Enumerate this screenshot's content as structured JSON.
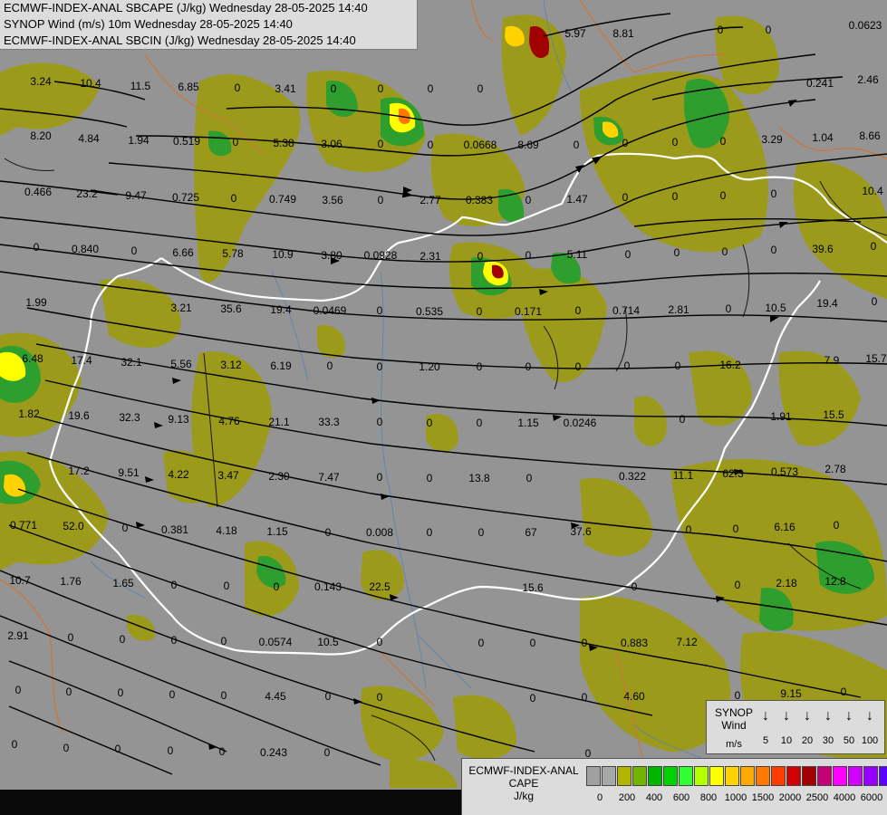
{
  "header": {
    "line1": "ECMWF-INDEX-ANAL SBCAPE (J/kg) Wednesday 28-05-2025 14:40",
    "line2": "SYNOP Wind (m/s) 10m Wednesday 28-05-2025 14:40",
    "line3": "ECMWF-INDEX-ANAL SBCIN (J/kg) Wednesday 28-05-2025 14:40"
  },
  "values": [
    "3.24",
    "10.4",
    "11.5",
    "6.85",
    "0",
    "3.41",
    "0",
    "0",
    "0",
    "0",
    "5.97",
    "8.81",
    "0",
    "0",
    "0.0623",
    "8.20",
    "4.84",
    "1.94",
    "0.519",
    "0",
    "5.38",
    "3.06",
    "0",
    "0",
    "0.0668",
    "8.69",
    "0",
    "0",
    "0",
    "0",
    "3.29",
    "1.04",
    "8.66",
    "0.241",
    "2.46",
    "0.466",
    "23.2",
    "9.47",
    "0.725",
    "0",
    "0.749",
    "3.56",
    "0",
    "2.77",
    "0.383",
    "0",
    "1.47",
    "0",
    "0",
    "0",
    "0",
    "10.4",
    "0.840",
    "0",
    "0",
    "6.66",
    "5.78",
    "10.9",
    "3.80",
    "0.0928",
    "2.31",
    "0",
    "0",
    "5.11",
    "0",
    "0",
    "0",
    "0",
    "39.6",
    "0",
    "1.99",
    "3.21",
    "35.6",
    "19.4",
    "0.0469",
    "0",
    "0.535",
    "0",
    "0.171",
    "0",
    "0.714",
    "2.81",
    "0",
    "10.5",
    "19.4",
    "0",
    "6.48",
    "17.4",
    "32.1",
    "5.56",
    "3.12",
    "6.19",
    "0",
    "0",
    "1.20",
    "0",
    "0",
    "0",
    "0",
    "0",
    "16.2",
    "7.9",
    "15.7",
    "1.82",
    "19.6",
    "32.3",
    "9.13",
    "4.76",
    "21.1",
    "33.3",
    "0",
    "0",
    "0",
    "1.15",
    "0.0246",
    "0",
    "1.91",
    "15.5",
    "17.2",
    "9.51",
    "4.22",
    "3.47",
    "2.30",
    "7.47",
    "0",
    "0",
    "13.8",
    "0",
    "0.322",
    "11.1",
    "62.3",
    "0.573",
    "2.78",
    "0.771",
    "52.0",
    "0",
    "0.381",
    "4.18",
    "1.15",
    "0",
    "0.008",
    "0",
    "0",
    "67",
    "37.6",
    "0",
    "0",
    "6.16",
    "0",
    "10.7",
    "1.76",
    "1.65",
    "0",
    "0",
    "0",
    "0.143",
    "22.5",
    "15.6",
    "0",
    "0",
    "2.18",
    "12.8",
    "2.91",
    "0",
    "0",
    "0",
    "0",
    "0.0574",
    "10.5",
    "0",
    "0",
    "0",
    "0",
    "0.883",
    "7.12",
    "0",
    "0",
    "0",
    "0",
    "0",
    "4.45",
    "0",
    "0",
    "0",
    "0",
    "4.60",
    "0",
    "9.15",
    "0",
    "0",
    "0",
    "0",
    "0",
    "0",
    "0.243",
    "0",
    "0"
  ],
  "wind_legend": {
    "title_line1": "SYNOP",
    "title_line2": "Wind",
    "unit": "m/s",
    "speeds": [
      "5",
      "10",
      "20",
      "30",
      "50",
      "100"
    ]
  },
  "cape_legend": {
    "title_line1": "ECMWF-INDEX-ANAL",
    "title_line2": "CAPE",
    "unit": "J/kg",
    "ticks": [
      "0",
      "200",
      "400",
      "600",
      "800",
      "1000",
      "1500",
      "2000",
      "2500",
      "4000",
      "6000"
    ],
    "colors": [
      "#a0a0a0",
      "#a8a8a8",
      "#b4b400",
      "#73b400",
      "#00b400",
      "#00d200",
      "#32ff32",
      "#b4ff00",
      "#ffff00",
      "#ffd200",
      "#ffaa00",
      "#ff7800",
      "#ff3c00",
      "#d20000",
      "#a00000",
      "#c80078",
      "#ff00ff",
      "#d200ff",
      "#9600ff",
      "#5a00ff",
      "#0000ff",
      "#0064ff",
      "#00c8ff",
      "#32ffff",
      "#ffffff"
    ]
  }
}
